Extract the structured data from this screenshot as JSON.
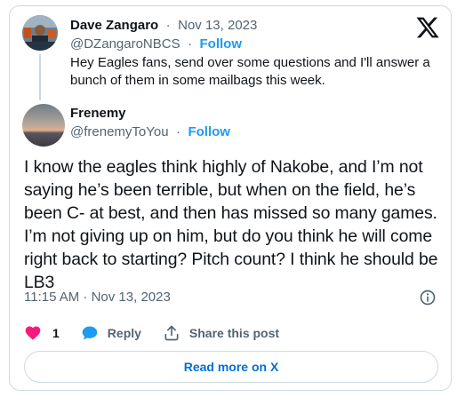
{
  "parent": {
    "name": "Dave Zangaro",
    "date": "Nov 13, 2023",
    "handle": "@DZangaroNBCS",
    "follow_label": "Follow",
    "text": "Hey Eagles fans, send over some questions and I'll answer a bunch of them in some mailbags this week."
  },
  "reply": {
    "name": "Frenemy",
    "handle": "@frenemyToYou",
    "follow_label": "Follow",
    "text": "I know the eagles think highly of Nakobe, and I’m not saying he’s been terrible, but when on the field, he’s been C- at best, and then has missed so many games. I’m not giving up on him, but do you think he will come right back to starting? Pitch count? I think he should be LB3",
    "timestamp": "11:15 AM · Nov 13, 2023"
  },
  "actions": {
    "likes": "1",
    "reply_label": "Reply",
    "share_label": "Share this post"
  },
  "read_more_label": "Read more on X",
  "separator": "·",
  "icons": {
    "brand": "x-logo-icon",
    "info": "info-icon",
    "like": "heart-icon",
    "reply": "reply-bubble-icon",
    "share": "share-icon"
  },
  "colors": {
    "accent": "#1d9bf0",
    "link": "#006fd6",
    "like": "#f91880",
    "muted": "#536471",
    "text": "#0f1419",
    "border": "#cfd9de"
  }
}
